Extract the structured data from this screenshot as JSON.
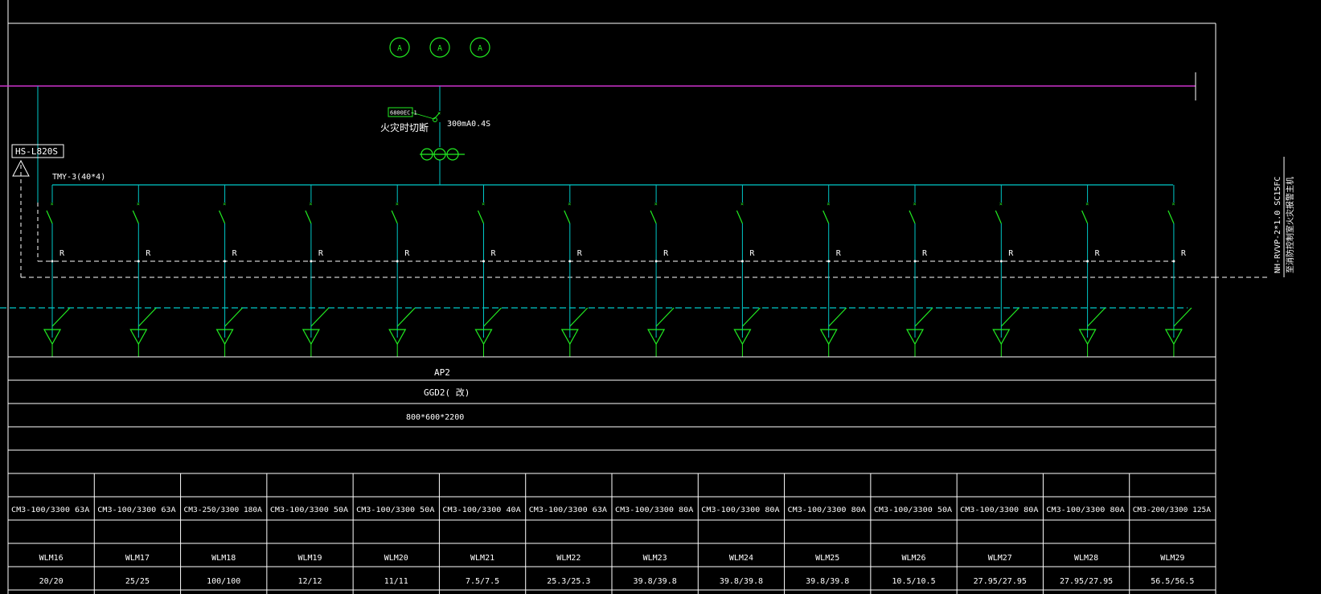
{
  "colors": {
    "background": "#000000",
    "frame": "#ffffff",
    "bus": "#00c8c8",
    "magenta_bus": "#cc33cc",
    "symbol": "#22ee22",
    "dashed_white": "#ffffff",
    "dashed_cyan": "#00c8c8"
  },
  "header": {
    "ammeter_symbol": "A",
    "ammeter_count": 3
  },
  "incoming": {
    "breaker_tag": "6800EC-1",
    "fire_cut_label": "火灾时切断",
    "leakage_label": "300mA0.4S",
    "busbar_label": "TMY-3(40*4)",
    "surge_device_label": "HS-L820S"
  },
  "right_cable_label": {
    "line1": "NH-RVVP-2*1.0  SC15FC",
    "line2": "至消防控制室火灾报警主机"
  },
  "panel_info": {
    "name": "AP2",
    "cabinet_type": "GGD2( 改)",
    "dimensions": "800*600*2200"
  },
  "feeders": [
    {
      "breaker": "CM3-100/3300 63A",
      "circuit": "WLM16",
      "load": "20/20",
      "relay": "R"
    },
    {
      "breaker": "CM3-100/3300 63A",
      "circuit": "WLM17",
      "load": "25/25",
      "relay": "R"
    },
    {
      "breaker": "CM3-250/3300 180A",
      "circuit": "WLM18",
      "load": "100/100",
      "relay": "R"
    },
    {
      "breaker": "CM3-100/3300 50A",
      "circuit": "WLM19",
      "load": "12/12",
      "relay": "R"
    },
    {
      "breaker": "CM3-100/3300 50A",
      "circuit": "WLM20",
      "load": "11/11",
      "relay": "R"
    },
    {
      "breaker": "CM3-100/3300 40A",
      "circuit": "WLM21",
      "load": "7.5/7.5",
      "relay": "R"
    },
    {
      "breaker": "CM3-100/3300 63A",
      "circuit": "WLM22",
      "load": "25.3/25.3",
      "relay": "R"
    },
    {
      "breaker": "CM3-100/3300 80A",
      "circuit": "WLM23",
      "load": "39.8/39.8",
      "relay": "R"
    },
    {
      "breaker": "CM3-100/3300 80A",
      "circuit": "WLM24",
      "load": "39.8/39.8",
      "relay": "R"
    },
    {
      "breaker": "CM3-100/3300 80A",
      "circuit": "WLM25",
      "load": "39.8/39.8",
      "relay": "R"
    },
    {
      "breaker": "CM3-100/3300 50A",
      "circuit": "WLM26",
      "load": "10.5/10.5",
      "relay": "R"
    },
    {
      "breaker": "CM3-100/3300 80A",
      "circuit": "WLM27",
      "load": "27.95/27.95",
      "relay": "R"
    },
    {
      "breaker": "CM3-100/3300 80A",
      "circuit": "WLM28",
      "load": "27.95/27.95",
      "relay": "R"
    },
    {
      "breaker": "CM3-200/3300 125A",
      "circuit": "WLM29",
      "load": "56.5/56.5",
      "relay": "R"
    }
  ]
}
